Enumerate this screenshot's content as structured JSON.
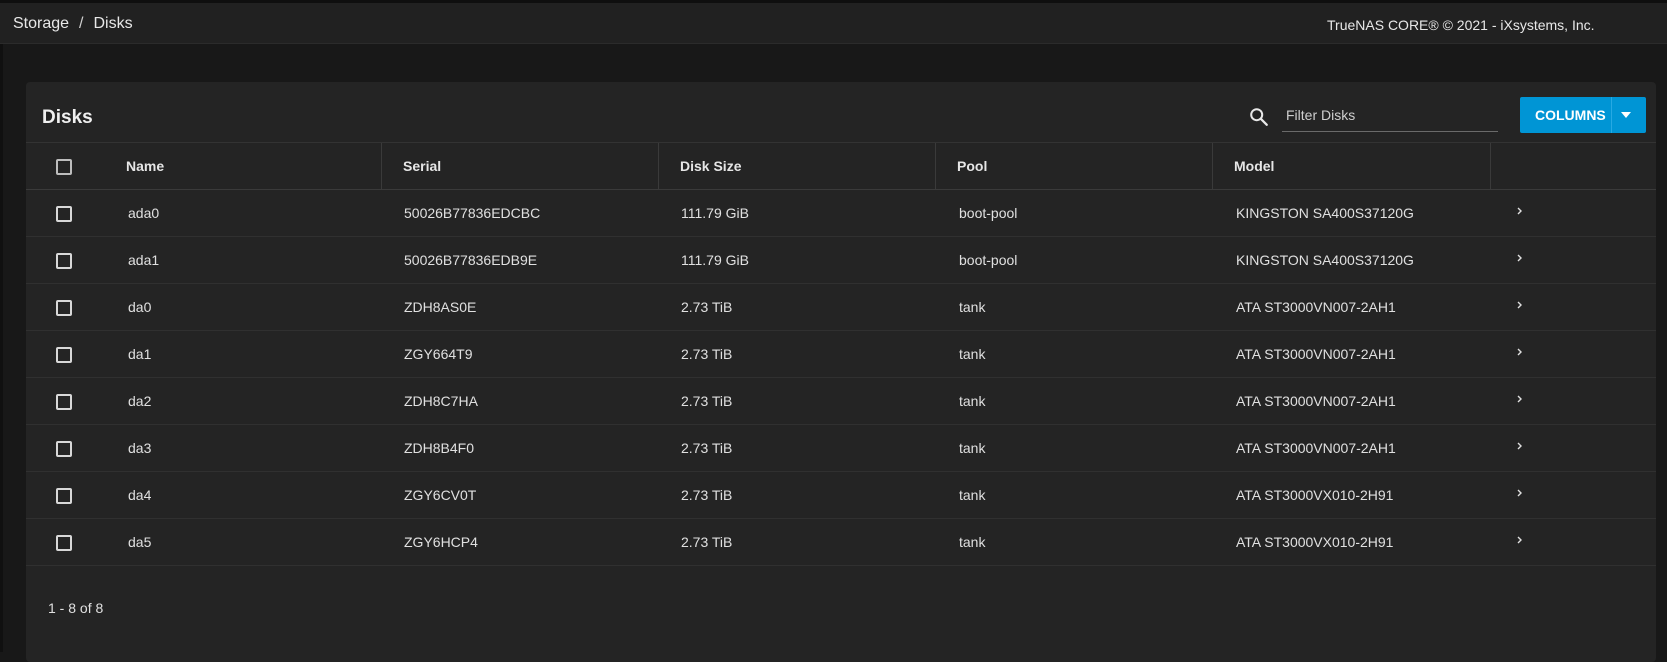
{
  "breadcrumb": {
    "parent": "Storage",
    "separator": "/",
    "current": "Disks"
  },
  "copyright": "TrueNAS CORE® © 2021 - iXsystems, Inc.",
  "card": {
    "title": "Disks",
    "filter_placeholder": "Filter Disks",
    "columns_label": "COLUMNS"
  },
  "table": {
    "headers": {
      "name": "Name",
      "serial": "Serial",
      "disk_size": "Disk Size",
      "pool": "Pool",
      "model": "Model"
    },
    "rows": [
      {
        "name": "ada0",
        "serial": "50026B77836EDCBC",
        "disk_size": "111.79 GiB",
        "pool": "boot-pool",
        "model": "KINGSTON SA400S37120G"
      },
      {
        "name": "ada1",
        "serial": "50026B77836EDB9E",
        "disk_size": "111.79 GiB",
        "pool": "boot-pool",
        "model": "KINGSTON SA400S37120G"
      },
      {
        "name": "da0",
        "serial": "ZDH8AS0E",
        "disk_size": "2.73 TiB",
        "pool": "tank",
        "model": "ATA ST3000VN007-2AH1"
      },
      {
        "name": "da1",
        "serial": "ZGY664T9",
        "disk_size": "2.73 TiB",
        "pool": "tank",
        "model": "ATA ST3000VN007-2AH1"
      },
      {
        "name": "da2",
        "serial": "ZDH8C7HA",
        "disk_size": "2.73 TiB",
        "pool": "tank",
        "model": "ATA ST3000VN007-2AH1"
      },
      {
        "name": "da3",
        "serial": "ZDH8B4F0",
        "disk_size": "2.73 TiB",
        "pool": "tank",
        "model": "ATA ST3000VN007-2AH1"
      },
      {
        "name": "da4",
        "serial": "ZGY6CV0T",
        "disk_size": "2.73 TiB",
        "pool": "tank",
        "model": "ATA ST3000VX010-2H91"
      },
      {
        "name": "da5",
        "serial": "ZGY6HCP4",
        "disk_size": "2.73 TiB",
        "pool": "tank",
        "model": "ATA ST3000VX010-2H91"
      }
    ]
  },
  "pagination": "1 - 8 of 8",
  "colors": {
    "accent": "#0095d5",
    "background": "#181818",
    "card": "#242424"
  }
}
